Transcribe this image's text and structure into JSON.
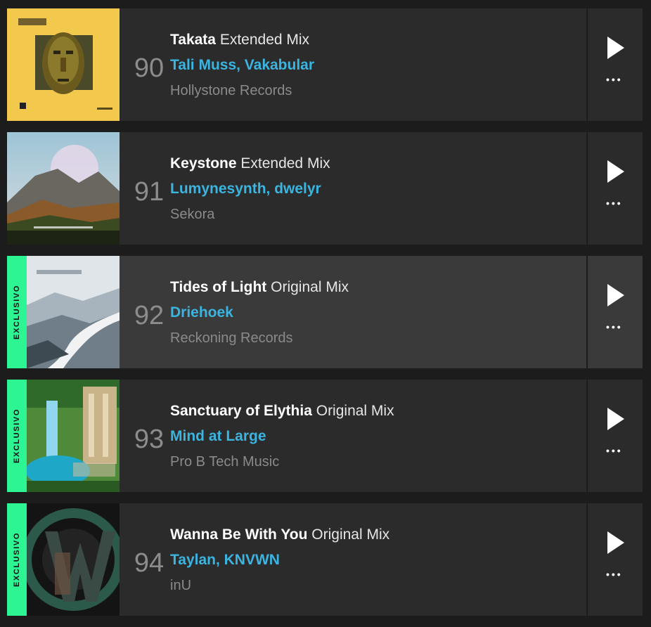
{
  "exclusive_label": "EXCLUSIVO",
  "colors": {
    "accent_artist": "#3cb4e0",
    "exclusive_badge": "#2ef594",
    "row_bg": "#2b2b2b",
    "row_highlight_bg": "#3a3a3a"
  },
  "tracks": [
    {
      "rank": "90",
      "title": "Takata",
      "mix": "Extended Mix",
      "artists": "Tali Muss, Vakabular",
      "label": "Hollystone Records",
      "exclusive": false,
      "highlight": false
    },
    {
      "rank": "91",
      "title": "Keystone",
      "mix": "Extended Mix",
      "artists": "Lumynesynth, dwelyr",
      "label": "Sekora",
      "exclusive": false,
      "highlight": false
    },
    {
      "rank": "92",
      "title": "Tides of Light",
      "mix": "Original Mix",
      "artists": "Driehoek",
      "label": "Reckoning Records",
      "exclusive": true,
      "highlight": true
    },
    {
      "rank": "93",
      "title": "Sanctuary of Elythia",
      "mix": "Original Mix",
      "artists": "Mind at Large",
      "label": "Pro B Tech Music",
      "exclusive": true,
      "highlight": false
    },
    {
      "rank": "94",
      "title": "Wanna Be With You",
      "mix": "Original Mix",
      "artists": "Taylan, KNVWN",
      "label": "inU",
      "exclusive": true,
      "highlight": false
    }
  ],
  "icons": {
    "play": "play-icon",
    "more": "more-options-icon"
  }
}
